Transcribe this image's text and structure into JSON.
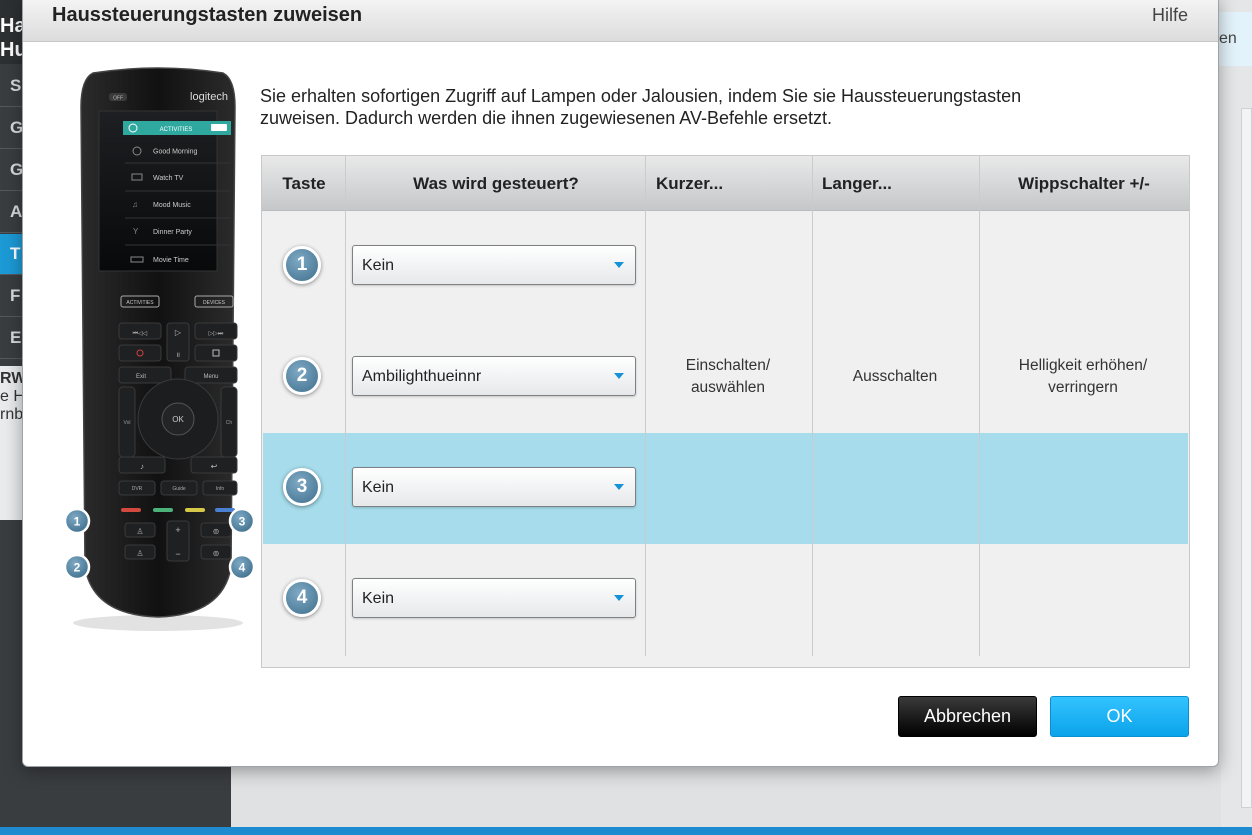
{
  "background": {
    "sidebar_title_line1": "Ha",
    "sidebar_title_line2": "Hu",
    "sidebar_items": [
      "S",
      "G",
      "G",
      "A",
      "T",
      "F",
      "E"
    ],
    "text_bold": "RW",
    "text_line1": "e H",
    "text_line2": "rnb",
    "right_tab_label": "en"
  },
  "dialog": {
    "title": "Haussteuerungstasten zuweisen",
    "help_label": "Hilfe",
    "intro_line1": "Sie erhalten sofortigen Zugriff auf Lampen oder Jalousien, indem Sie sie Haussteuerungstasten",
    "intro_line2": "zuweisen. Dadurch werden die ihnen zugewiesenen AV-Befehle ersetzt."
  },
  "remote": {
    "brand": "logitech",
    "power_label": "OFF",
    "screen_header": "ACTIVITIES",
    "screen_items": [
      "Good Morning",
      "Watch TV",
      "Mood Music",
      "Dinner Party",
      "Movie Time"
    ],
    "activities_button": "ACTIVITIES",
    "devices_button": "DEVICES",
    "exit_label": "Exit",
    "menu_label": "Menu",
    "ok_label": "OK",
    "vol_label": "Vol",
    "ch_label": "Ch",
    "dvr_label": "DVR",
    "guide_label": "Guide",
    "info_label": "Info",
    "callouts": [
      "1",
      "2",
      "3",
      "4"
    ]
  },
  "table": {
    "headers": {
      "key": "Taste",
      "controlled": "Was wird gesteuert?",
      "short": "Kurzer...",
      "long": "Langer...",
      "rocker": "Wippschalter +/-"
    },
    "rows": [
      {
        "num": "1",
        "device": "Kein",
        "short": "",
        "long": "",
        "rocker": ""
      },
      {
        "num": "2",
        "device": "Ambilighthueinnr",
        "short": "Einschalten/ auswählen",
        "long": "Ausschalten",
        "rocker": "Helligkeit erhöhen/ verringern"
      },
      {
        "num": "3",
        "device": "Kein",
        "short": "",
        "long": "",
        "rocker": ""
      },
      {
        "num": "4",
        "device": "Kein",
        "short": "",
        "long": "",
        "rocker": ""
      }
    ],
    "highlighted_row": 3,
    "highlight_color": "#a6dceb"
  },
  "buttons": {
    "cancel": "Abbrechen",
    "ok": "OK"
  },
  "colors": {
    "accent": "#1593d6",
    "ok_button": "#1aaef0",
    "cancel_button": "#111111"
  }
}
